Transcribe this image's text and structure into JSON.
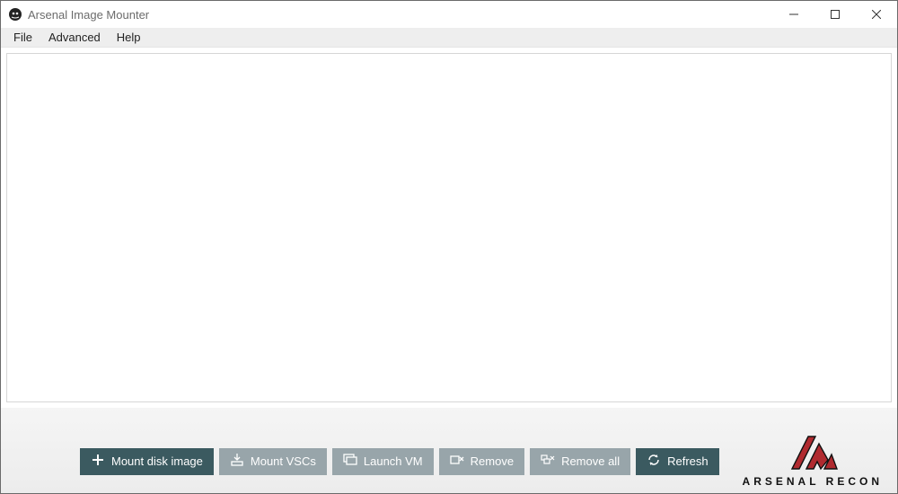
{
  "window": {
    "title": "Arsenal Image Mounter"
  },
  "menubar": {
    "items": [
      "File",
      "Advanced",
      "Help"
    ]
  },
  "toolbar": {
    "mount_disk_image": "Mount disk image",
    "mount_vscs": "Mount VSCs",
    "launch_vm": "Launch VM",
    "remove": "Remove",
    "remove_all": "Remove all",
    "refresh": "Refresh"
  },
  "brand": {
    "name": "ARSENAL RECON"
  },
  "colors": {
    "primary_button": "#3b5a60",
    "muted_button": "#98a5aa",
    "brand_red": "#b02a2f"
  }
}
